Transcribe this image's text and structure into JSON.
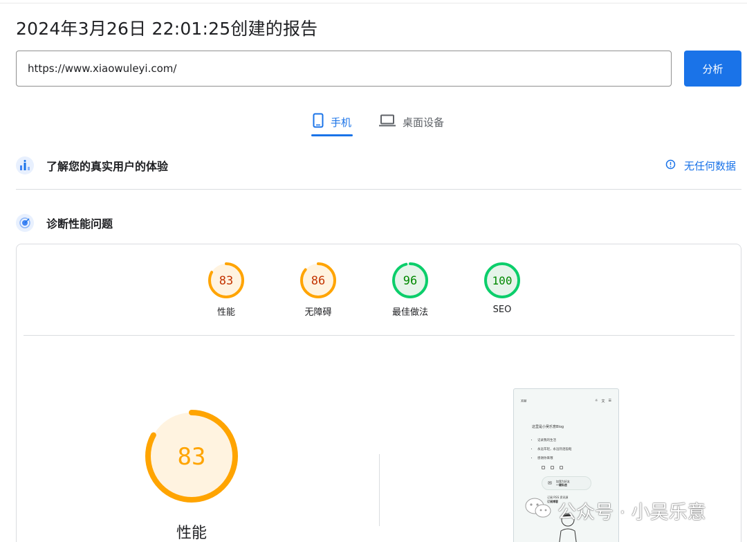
{
  "report": {
    "title": "2024年3月26日 22:01:25创建的报告"
  },
  "url_input": {
    "value": "https://www.xiaowuleyi.com/"
  },
  "analyze_button": {
    "label": "分析"
  },
  "tabs": [
    {
      "label": "手机",
      "icon": "smartphone-icon",
      "active": true
    },
    {
      "label": "桌面设备",
      "icon": "laptop-icon",
      "active": false
    }
  ],
  "field_data": {
    "heading": "了解您的真实用户的体验",
    "status": "无任何数据",
    "icon": "user-experience-icon"
  },
  "diagnostics": {
    "heading": "诊断性能问题",
    "icon": "diagnose-icon"
  },
  "scores": [
    {
      "label": "性能",
      "value": 83,
      "color": "#ffa400",
      "text_color": "#c33300",
      "bg": "#fff3e0"
    },
    {
      "label": "无障碍",
      "value": 86,
      "color": "#ffa400",
      "text_color": "#c33300",
      "bg": "#fff3e0"
    },
    {
      "label": "最佳做法",
      "value": 96,
      "color": "#0cce6b",
      "text_color": "#008800",
      "bg": "#e6f4ea"
    },
    {
      "label": "SEO",
      "value": 100,
      "color": "#0cce6b",
      "text_color": "#008800",
      "bg": "#e6f4ea"
    }
  ],
  "main_score": {
    "value": 83,
    "label": "性能",
    "color": "#ffa400",
    "text_color": "#ffa400",
    "bg": "#fff3e0"
  },
  "screenshot_preview": {
    "logo": "XW",
    "title": "这里是小吴乐意Blog",
    "items": [
      "记录我的生活",
      "永远年轻，永远热泪盈眶",
      "感谢你来哦"
    ],
    "card_line1": "加我为好友",
    "card_line2": "一键私信",
    "feed_line1": "订阅 RSS 资讯源",
    "feed_line2": "订阅博客"
  },
  "watermark": {
    "text": "公众号 · 小吴乐意"
  },
  "colors": {
    "accent": "#1a73e8",
    "average": "#ffa400",
    "pass": "#0cce6b"
  }
}
